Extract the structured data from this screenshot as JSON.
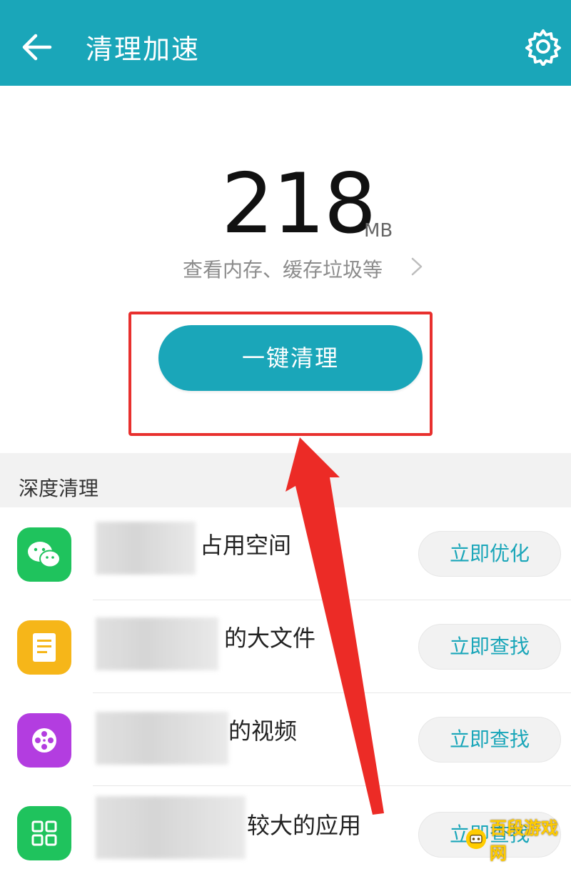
{
  "header": {
    "title": "清理加速"
  },
  "storage": {
    "value": "218",
    "unit": "MB",
    "detail_link": "查看内存、缓存垃圾等"
  },
  "clean_button": {
    "label": "一键清理"
  },
  "deep_clean": {
    "section_title": "深度清理",
    "items": [
      {
        "label": "占用空间",
        "action": "立即优化",
        "icon": "wechat-icon",
        "color": "#1fc35d"
      },
      {
        "label": "的大文件",
        "action": "立即查找",
        "icon": "document-icon",
        "color": "#f6b619"
      },
      {
        "label": "的视频",
        "action": "立即查找",
        "icon": "film-reel-icon",
        "color": "#b33de0"
      },
      {
        "label": "较大的应用",
        "action": "立即查找",
        "icon": "app-grid-icon",
        "color": "#1fc35d"
      }
    ]
  },
  "colors": {
    "accent": "#1aa6b9",
    "highlight": "#e8302e"
  },
  "watermark": {
    "text": "百段游戏网"
  }
}
